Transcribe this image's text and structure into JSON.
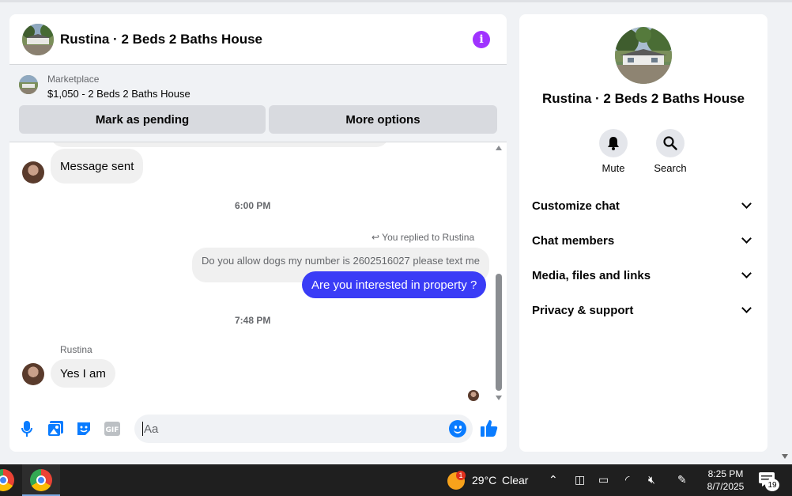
{
  "chat": {
    "title": "Rustina · 2 Beds 2 Baths House",
    "marketplace": {
      "source": "Marketplace",
      "item": "$1,050 - 2 Beds 2 Baths House",
      "pending_label": "Mark as pending",
      "more_label": "More options"
    },
    "messages": {
      "first": "Message sent",
      "time1": "6:00 PM",
      "reply_note": "You replied to Rustina",
      "quoted": "Do you allow dogs my number is 2602516027 please text me",
      "outgoing": "Are you interested in property ?",
      "time2": "7:48 PM",
      "sender": "Rustina",
      "incoming": "Yes I am"
    },
    "composer": {
      "placeholder": "Aa"
    }
  },
  "side": {
    "title": "Rustina · 2 Beds 2 Baths House",
    "mute_label": "Mute",
    "search_label": "Search",
    "sections": [
      "Customize chat",
      "Chat members",
      "Media, files and links",
      "Privacy & support"
    ]
  },
  "taskbar": {
    "weather_badge": "1",
    "temperature": "29°C",
    "condition": "Clear",
    "time": "8:25 PM",
    "date": "8/7/2025",
    "notifications": "19"
  },
  "colors": {
    "accent": "#0a7cff",
    "outgoing_bubble": "#3a3cf6",
    "info": "#a033ff"
  }
}
